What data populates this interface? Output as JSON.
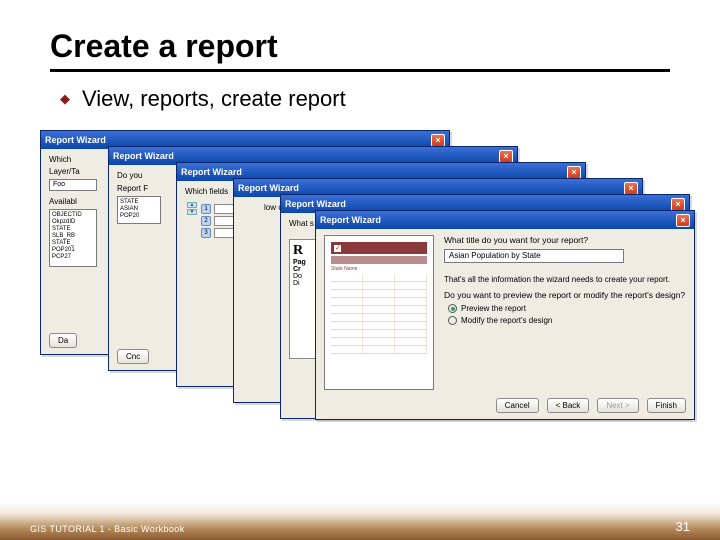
{
  "title": "Create a report",
  "bullet_text": "View, reports, create report",
  "wizard_title": "Report Wizard",
  "win1": {
    "q1": "Which",
    "lbl_layer": "Layer/Ta",
    "layer_val": "Foo",
    "lbl_avail": "Availabl",
    "fields": [
      "OBJECTID",
      "OkpzdID",
      "STATE",
      "SLB_RB",
      "STATE_",
      "POP201",
      "PCP27"
    ],
    "btn": "Da"
  },
  "win2": {
    "q": "Do you",
    "lbl": "Report F",
    "vals": [
      "STATE",
      "ASIAN",
      "POP20"
    ],
    "btn": "Cnc"
  },
  "win3": {
    "q": "Which fields",
    "rows": [
      "1",
      "2",
      "3"
    ]
  },
  "win4": {
    "q": "low co"
  },
  "win5": {
    "q": "What s",
    "r": "R",
    "lines": [
      "Pag",
      "Cr",
      "Do",
      "Di"
    ]
  },
  "final": {
    "q_title": "What title do you want for your report?",
    "title_value": "Asian Population by State",
    "info": "That's all the information the wizard needs to create your report.",
    "q2": "Do you want to preview the report or modify the report's design?",
    "opt_preview": "Preview the report",
    "opt_modify": "Modify the report's design",
    "preview_label": "State Name",
    "btn_cancel": "Cancel",
    "btn_back": "< Back",
    "btn_next": "Next >",
    "btn_finish": "Finish"
  },
  "footer_left": "GIS TUTORIAL 1 - Basic Workbook",
  "footer_right": "31"
}
